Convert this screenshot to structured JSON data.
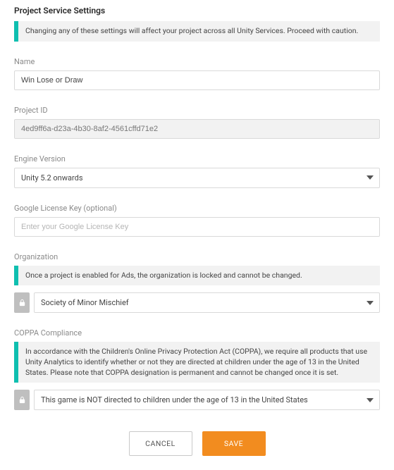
{
  "heading": "Project Service Settings",
  "top_banner": "Changing any of these settings will affect your project across all Unity Services. Proceed with caution.",
  "name": {
    "label": "Name",
    "value": "Win Lose or Draw"
  },
  "project_id": {
    "label": "Project ID",
    "value": "4ed9ff6a-d23a-4b30-8af2-4561cffd71e2"
  },
  "engine_version": {
    "label": "Engine Version",
    "value": "Unity 5.2 onwards"
  },
  "google_license": {
    "label": "Google License Key (optional)",
    "placeholder": "Enter your Google License Key"
  },
  "organization": {
    "label": "Organization",
    "banner": "Once a project is enabled for Ads, the organization is locked and cannot be changed.",
    "value": "Society of Minor Mischief"
  },
  "coppa": {
    "label": "COPPA Compliance",
    "banner": "In accordance with the Children's Online Privacy Protection Act (COPPA), we require all products that use Unity Analytics to identify whether or not they are directed at children under the age of 13 in the United States. Please note that COPPA designation is permanent and cannot be changed once it is set.",
    "value": "This game is NOT directed to children under the age of 13 in the United States"
  },
  "buttons": {
    "cancel": "CANCEL",
    "save": "SAVE"
  }
}
